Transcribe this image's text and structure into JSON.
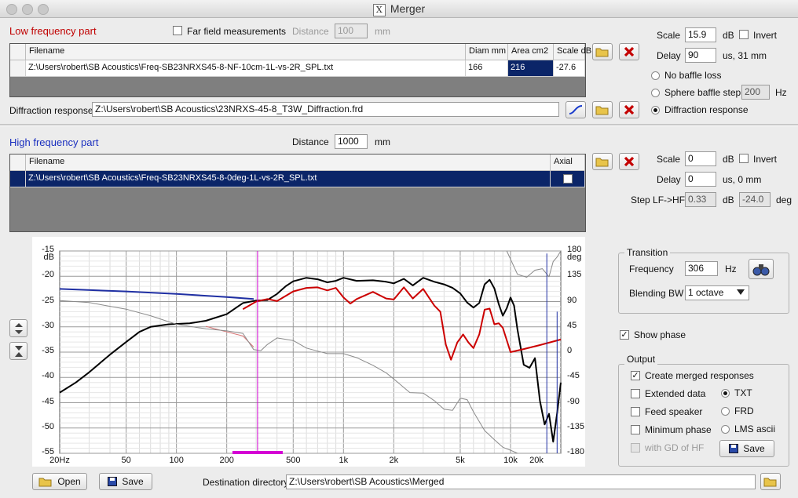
{
  "window": {
    "title": "Merger",
    "logo": "X"
  },
  "low": {
    "title": "Low frequency part",
    "far_field_label": "Far field measurements",
    "distance_label": "Distance",
    "distance_value": "100",
    "distance_unit": "mm",
    "columns": [
      "Filename",
      "Diam mm",
      "Area cm2",
      "Scale dB"
    ],
    "row": {
      "filename": "Z:\\Users\\robert\\SB Acoustics\\Freq-SB23NRXS45-8-NF-10cm-1L-vs-2R_SPL.txt",
      "diam": "166",
      "area": "216",
      "scale": "-27.6"
    },
    "diffraction_label": "Diffraction response",
    "diffraction_file": "Z:\\Users\\robert\\SB Acoustics\\23NRXS-45-8_T3W_Diffraction.frd",
    "scale_label": "Scale",
    "scale_value": "15.9",
    "scale_unit": "dB",
    "invert_label": "Invert",
    "delay_label": "Delay",
    "delay_value": "90",
    "delay_unit": "us, 31 mm",
    "radio_no_baffle": "No baffle loss",
    "radio_sphere": "Sphere baffle step",
    "sphere_value": "200",
    "sphere_unit": "Hz",
    "radio_diffraction": "Diffraction response"
  },
  "high": {
    "title": "High frequency part",
    "distance_label": "Distance",
    "distance_value": "1000",
    "distance_unit": "mm",
    "columns": [
      "Filename",
      "Axial"
    ],
    "row": {
      "filename": "Z:\\Users\\robert\\SB Acoustics\\Freq-SB23NRXS45-8-0deg-1L-vs-2R_SPL.txt",
      "axial": "✓"
    },
    "scale_label": "Scale",
    "scale_value": "0",
    "scale_unit": "dB",
    "invert_label": "Invert",
    "delay_label": "Delay",
    "delay_value": "0",
    "delay_unit": "us,  0 mm",
    "step_label": "Step LF->HF",
    "step_value": "0.33",
    "step_unit": "dB",
    "step_deg": "-24.0",
    "step_deg_unit": "deg"
  },
  "transition": {
    "title": "Transition",
    "freq_label": "Frequency",
    "freq_value": "306",
    "freq_unit": "Hz",
    "blend_label": "Blending BW",
    "blend_value": "1 octave"
  },
  "show_phase_label": "Show phase",
  "output": {
    "title": "Output",
    "create_merged": "Create merged responses",
    "extended": "Extended data",
    "feed_speaker": "Feed speaker",
    "min_phase": "Minimum phase",
    "gd_hf": "with GD of HF",
    "fmt_txt": "TXT",
    "fmt_frd": "FRD",
    "fmt_lms": "LMS ascii",
    "save_label": "Save"
  },
  "bottom": {
    "open_label": "Open",
    "save_label": "Save",
    "dest_label": "Destination directory",
    "dest_value": "Z:\\Users\\robert\\SB Acoustics\\Merged"
  },
  "chart_data": {
    "type": "line",
    "x_scale": "log",
    "xlim": [
      20,
      20000
    ],
    "ylim": [
      -55,
      -15
    ],
    "ylim_right": [
      -180,
      180
    ],
    "ylabel": "dB",
    "ylabel_right": "deg",
    "x_ticks": [
      {
        "v": 20,
        "t": "20Hz"
      },
      {
        "v": 50,
        "t": "50"
      },
      {
        "v": 100,
        "t": "100"
      },
      {
        "v": 200,
        "t": "200"
      },
      {
        "v": 500,
        "t": "500"
      },
      {
        "v": 1000,
        "t": "1k"
      },
      {
        "v": 2000,
        "t": "2k"
      },
      {
        "v": 5000,
        "t": "5k"
      },
      {
        "v": 10000,
        "t": "10k"
      },
      {
        "v": 20000,
        "t": "20k"
      }
    ],
    "y_ticks": [
      "-15",
      "-20",
      "-25",
      "-30",
      "-35",
      "-40",
      "-45",
      "-50",
      "-55"
    ],
    "y_ticks_right": [
      "180",
      "135",
      "90",
      "45",
      "0",
      "-45",
      "-90",
      "-135",
      "-180"
    ],
    "crossover_hz": 306,
    "series": [
      {
        "color": "#000000",
        "width": 2,
        "points": [
          [
            20,
            -43
          ],
          [
            25,
            -41
          ],
          [
            30,
            -39
          ],
          [
            40,
            -35.5
          ],
          [
            50,
            -33
          ],
          [
            60,
            -31
          ],
          [
            70,
            -30
          ],
          [
            90,
            -29.5
          ],
          [
            120,
            -29.3
          ],
          [
            150,
            -28.8
          ],
          [
            200,
            -27.5
          ],
          [
            250,
            -25.3
          ],
          [
            300,
            -24.8
          ],
          [
            350,
            -24.7
          ],
          [
            400,
            -23.5
          ],
          [
            450,
            -22
          ],
          [
            500,
            -21
          ],
          [
            600,
            -20.3
          ],
          [
            700,
            -20.6
          ],
          [
            800,
            -21.2
          ],
          [
            900,
            -20.9
          ],
          [
            1000,
            -20.3
          ],
          [
            1200,
            -20.9
          ],
          [
            1500,
            -20.8
          ],
          [
            1800,
            -21.1
          ],
          [
            2000,
            -21.4
          ],
          [
            2300,
            -20.5
          ],
          [
            2600,
            -21.8
          ],
          [
            3000,
            -20.3
          ],
          [
            3500,
            -21.1
          ],
          [
            4000,
            -21.6
          ],
          [
            4500,
            -22.3
          ],
          [
            5000,
            -23.4
          ],
          [
            5500,
            -25.2
          ],
          [
            6000,
            -26.2
          ],
          [
            6500,
            -25.3
          ],
          [
            7000,
            -21.6
          ],
          [
            7500,
            -20.7
          ],
          [
            8000,
            -22.4
          ],
          [
            8500,
            -25.5
          ],
          [
            9000,
            -27.8
          ],
          [
            9500,
            -26.3
          ],
          [
            10000,
            -24.2
          ],
          [
            10500,
            -25.8
          ],
          [
            11000,
            -30.5
          ],
          [
            12000,
            -37.5
          ],
          [
            13000,
            -38.1
          ],
          [
            14000,
            -36.2
          ],
          [
            15000,
            -44.6
          ],
          [
            16000,
            -49.3
          ],
          [
            17000,
            -47.2
          ],
          [
            18000,
            -52.7
          ],
          [
            19000,
            -47.1
          ],
          [
            20000,
            -41
          ]
        ]
      },
      {
        "color": "#cc0000",
        "width": 2,
        "points": [
          [
            250,
            -26.5
          ],
          [
            300,
            -25
          ],
          [
            350,
            -24.5
          ],
          [
            400,
            -24.9
          ],
          [
            500,
            -23
          ],
          [
            600,
            -22.3
          ],
          [
            700,
            -22.2
          ],
          [
            800,
            -22.8
          ],
          [
            900,
            -22.3
          ],
          [
            1000,
            -24.2
          ],
          [
            1100,
            -25.4
          ],
          [
            1200,
            -24.5
          ],
          [
            1500,
            -23.1
          ],
          [
            1800,
            -24.4
          ],
          [
            2000,
            -24.6
          ],
          [
            2300,
            -22.2
          ],
          [
            2600,
            -24.4
          ],
          [
            3000,
            -22.5
          ],
          [
            3500,
            -25.8
          ],
          [
            3800,
            -27
          ],
          [
            4100,
            -33.5
          ],
          [
            4400,
            -36.5
          ],
          [
            4800,
            -33.1
          ],
          [
            5200,
            -31.5
          ],
          [
            5600,
            -33.1
          ],
          [
            6000,
            -34.2
          ],
          [
            6500,
            -31.5
          ],
          [
            7000,
            -26.6
          ],
          [
            7500,
            -26.4
          ],
          [
            8000,
            -29.5
          ],
          [
            8500,
            -29.3
          ],
          [
            9000,
            -30.2
          ],
          [
            10000,
            -35
          ],
          [
            12000,
            -34.4
          ],
          [
            15000,
            -33.6
          ],
          [
            20000,
            -32.5
          ]
        ]
      },
      {
        "color": "#1f2fa3",
        "width": 2,
        "points": [
          [
            20,
            -22.5
          ],
          [
            50,
            -23
          ],
          [
            100,
            -23.5
          ],
          [
            200,
            -24.1
          ],
          [
            290,
            -24.5
          ]
        ]
      },
      {
        "color": "#d97373",
        "width": 1,
        "points": [
          [
            150,
            -29.9
          ],
          [
            200,
            -31
          ],
          [
            250,
            -31.8
          ],
          [
            290,
            -34
          ]
        ]
      },
      {
        "color": "#8a8a8a",
        "width": 1,
        "points": [
          [
            20,
            -24.8
          ],
          [
            30,
            -25.2
          ],
          [
            50,
            -26.5
          ],
          [
            70,
            -27.8
          ],
          [
            100,
            -29.5
          ],
          [
            150,
            -30.4
          ],
          [
            200,
            -30.8
          ],
          [
            250,
            -31.3
          ],
          [
            290,
            -34.5
          ],
          [
            320,
            -34.7
          ],
          [
            350,
            -33.5
          ],
          [
            400,
            -32.2
          ],
          [
            500,
            -32.7
          ],
          [
            600,
            -34.2
          ],
          [
            700,
            -34.8
          ],
          [
            800,
            -35.3
          ],
          [
            1000,
            -35.3
          ],
          [
            1200,
            -36.1
          ],
          [
            1500,
            -37.6
          ],
          [
            1800,
            -39.1
          ],
          [
            2000,
            -40.3
          ],
          [
            2500,
            -43
          ],
          [
            3000,
            -43.1
          ],
          [
            3500,
            -44.6
          ],
          [
            4000,
            -46.3
          ],
          [
            4500,
            -46.5
          ],
          [
            5000,
            -44.1
          ],
          [
            5500,
            -44.4
          ],
          [
            6000,
            -46.8
          ],
          [
            7000,
            -50.5
          ],
          [
            8000,
            -52.3
          ],
          [
            9000,
            -53.8
          ],
          [
            10000,
            -54.4
          ],
          [
            11000,
            -55
          ]
        ]
      },
      {
        "color": "#8a8a8a",
        "width": 1,
        "points": [
          [
            9500,
            -15
          ],
          [
            11000,
            -19.6
          ],
          [
            12500,
            -20.2
          ],
          [
            14000,
            -18.8
          ],
          [
            15500,
            -18.5
          ],
          [
            17000,
            -20.1
          ],
          [
            18000,
            -17.1
          ],
          [
            19000,
            -16.2
          ],
          [
            20000,
            -15
          ]
        ]
      },
      {
        "color": "#1f2fa3",
        "width": 1,
        "points": [
          [
            16500,
            -15.5
          ],
          [
            16500,
            -55
          ]
        ]
      },
      {
        "color": "#1f2fa3",
        "width": 1,
        "points": [
          [
            19000,
            -27
          ],
          [
            19000,
            -55
          ]
        ]
      }
    ]
  }
}
